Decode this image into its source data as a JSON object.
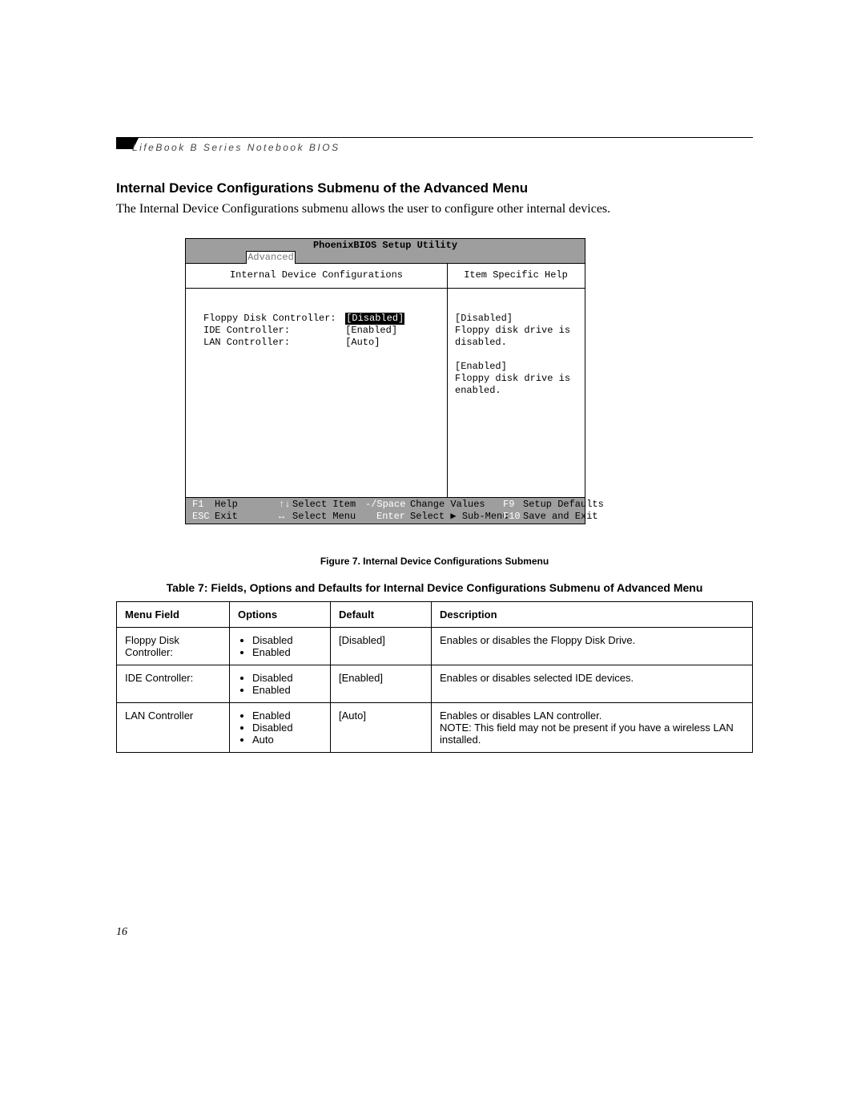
{
  "header": {
    "running_title": "LifeBook B Series Notebook BIOS"
  },
  "section": {
    "title": "Internal Device Configurations Submenu of the Advanced Menu",
    "intro": "The Internal Device Configurations submenu allows the user to configure other internal devices."
  },
  "bios": {
    "app_title": "PhoenixBIOS Setup Utility",
    "tab": "Advanced",
    "left_heading": "Internal Device Configurations",
    "right_heading": "Item Specific Help",
    "items": [
      {
        "label": "Floppy Disk Controller:",
        "value": "[Disabled]",
        "selected": true
      },
      {
        "label": "IDE Controller:",
        "value": "[Enabled]",
        "selected": false
      },
      {
        "label": "LAN Controller:",
        "value": "[Auto]",
        "selected": false
      }
    ],
    "help_lines": [
      "[Disabled]",
      "Floppy disk drive is disabled.",
      "",
      "[Enabled]",
      "Floppy disk drive is enabled."
    ],
    "footer": {
      "f1": {
        "key": "F1",
        "label": "Help"
      },
      "esc": {
        "key": "ESC",
        "label": "Exit"
      },
      "ud": {
        "key": "↑↓",
        "label": "Select Item"
      },
      "lr": {
        "key": "↔",
        "label": "Select Menu"
      },
      "minus": {
        "key": "-/Space",
        "label": "Change Values"
      },
      "enter": {
        "key": "Enter",
        "label": "Select ▶ Sub-Menu"
      },
      "f9": {
        "key": "F9",
        "label": "Setup Defaults"
      },
      "f10": {
        "key": "F10",
        "label": "Save and Exit"
      }
    }
  },
  "figure_caption": "Figure 7.  Internal Device Configurations Submenu",
  "table": {
    "title": "Table 7: Fields, Options and Defaults for Internal Device Configurations Submenu of Advanced Menu",
    "headers": [
      "Menu Field",
      "Options",
      "Default",
      "Description"
    ],
    "rows": [
      {
        "field": "Floppy Disk Controller:",
        "options": [
          "Disabled",
          "Enabled"
        ],
        "default": "[Disabled]",
        "description": "Enables or disables the Floppy Disk Drive."
      },
      {
        "field": "IDE Controller:",
        "options": [
          "Disabled",
          "Enabled"
        ],
        "default": "[Enabled]",
        "description": "Enables or disables selected IDE devices."
      },
      {
        "field": "LAN Controller",
        "options": [
          "Enabled",
          "Disabled",
          "Auto"
        ],
        "default": "[Auto]",
        "description": "Enables or disables LAN controller.\nNOTE: This field may not be present if you have a wireless LAN installed."
      }
    ]
  },
  "page_number": "16"
}
